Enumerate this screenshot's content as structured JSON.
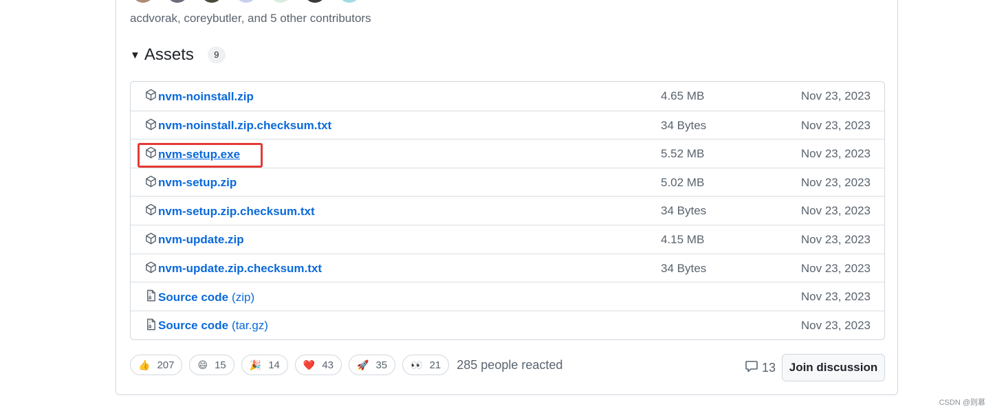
{
  "contributors": {
    "text": "acdvorak, coreybutler, and 5 other contributors"
  },
  "assets": {
    "title": "Assets",
    "count": "9",
    "rows": [
      {
        "name": "nvm-noinstall.zip",
        "suffix": "",
        "size": "4.65 MB",
        "date": "Nov 23, 2023",
        "icon": "package-icon"
      },
      {
        "name": "nvm-noinstall.zip.checksum.txt",
        "suffix": "",
        "size": "34 Bytes",
        "date": "Nov 23, 2023",
        "icon": "package-icon"
      },
      {
        "name": "nvm-setup.exe",
        "suffix": "",
        "size": "5.52 MB",
        "date": "Nov 23, 2023",
        "icon": "package-icon"
      },
      {
        "name": "nvm-setup.zip",
        "suffix": "",
        "size": "5.02 MB",
        "date": "Nov 23, 2023",
        "icon": "package-icon"
      },
      {
        "name": "nvm-setup.zip.checksum.txt",
        "suffix": "",
        "size": "34 Bytes",
        "date": "Nov 23, 2023",
        "icon": "package-icon"
      },
      {
        "name": "nvm-update.zip",
        "suffix": "",
        "size": "4.15 MB",
        "date": "Nov 23, 2023",
        "icon": "package-icon"
      },
      {
        "name": "nvm-update.zip.checksum.txt",
        "suffix": "",
        "size": "34 Bytes",
        "date": "Nov 23, 2023",
        "icon": "package-icon"
      },
      {
        "name": "Source code",
        "suffix": "(zip)",
        "size": "",
        "date": "Nov 23, 2023",
        "icon": "file-zip-icon"
      },
      {
        "name": "Source code",
        "suffix": "(tar.gz)",
        "size": "",
        "date": "Nov 23, 2023",
        "icon": "file-zip-icon"
      }
    ]
  },
  "reactions": {
    "items": [
      {
        "emoji": "👍",
        "count": "207",
        "icon": "thumbs-up-icon"
      },
      {
        "emoji": "😄",
        "count": "15",
        "icon": "laugh-icon"
      },
      {
        "emoji": "🎉",
        "count": "14",
        "icon": "hooray-icon"
      },
      {
        "emoji": "❤️",
        "count": "43",
        "icon": "heart-icon"
      },
      {
        "emoji": "🚀",
        "count": "35",
        "icon": "rocket-icon"
      },
      {
        "emoji": "👀",
        "count": "21",
        "icon": "eyes-icon"
      }
    ],
    "summary": "285 people reacted"
  },
  "discussion": {
    "comment_count": "13",
    "join_label": "Join discussion"
  },
  "watermark": "CSDN @则慕",
  "colors": {
    "link": "#0969da",
    "highlight": "#e53935",
    "muted": "#59636e"
  }
}
